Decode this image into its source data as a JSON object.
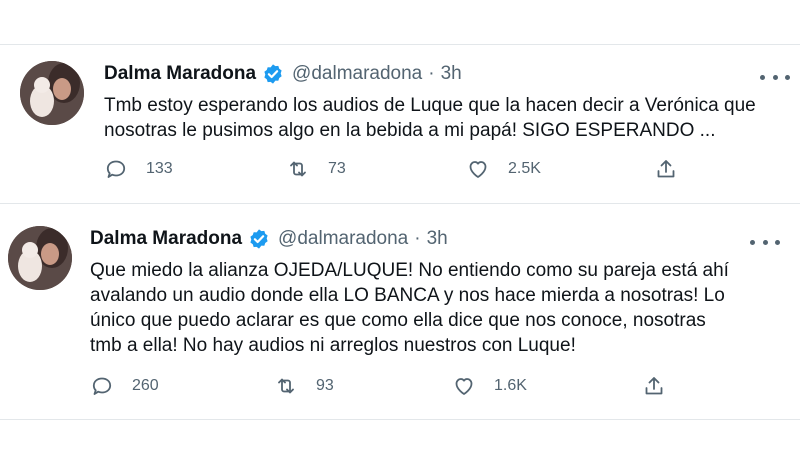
{
  "tweets": [
    {
      "name": "Dalma Maradona",
      "handle": "@dalmaradona",
      "separator": "·",
      "time": "3h",
      "text": "Tmb estoy esperando los audios de Luque que la hacen decir a Verónica que\nnosotras le pusimos algo en la bebida a mi papá! SIGO ESPERANDO ...",
      "replies": "133",
      "retweets": "73",
      "likes": "2.5K",
      "icons": [
        "reply-icon",
        "retweet-icon",
        "like-icon",
        "share-icon",
        "verified-badge-icon",
        "more-icon"
      ]
    },
    {
      "name": "Dalma Maradona",
      "handle": "@dalmaradona",
      "separator": "·",
      "time": "3h",
      "text": "Que miedo la alianza OJEDA/LUQUE! No entiendo como su pareja está ahí\navalando un audio donde ella LO BANCA y nos hace mierda a nosotras! Lo\núnico que puedo aclarar es que como ella dice que nos conoce, nosotras\ntmb a ella! No hay audios ni arreglos nuestros con Luque!",
      "replies": "260",
      "retweets": "93",
      "likes": "1.6K",
      "icons": [
        "reply-icon",
        "retweet-icon",
        "like-icon",
        "share-icon",
        "verified-badge-icon",
        "more-icon"
      ]
    }
  ],
  "colors": {
    "text": "#0f1419",
    "secondary": "#536471",
    "verified": "#1d9bf0",
    "divider": "#e3e7ea"
  }
}
